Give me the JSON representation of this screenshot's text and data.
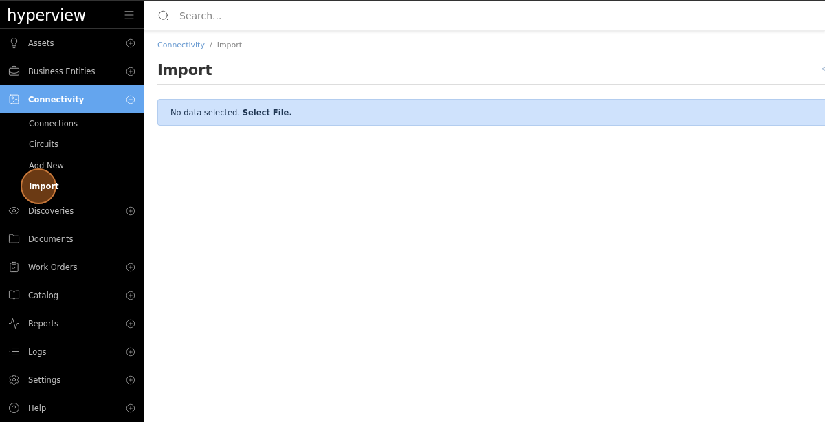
{
  "logo": "hyperview",
  "sidebar": {
    "items": [
      {
        "label": "Assets",
        "kind": "expandable",
        "expanded": false,
        "selected": false
      },
      {
        "label": "Business Entities",
        "kind": "expandable",
        "expanded": false,
        "selected": false
      },
      {
        "label": "Connectivity",
        "kind": "expandable",
        "expanded": true,
        "selected": true,
        "children": [
          {
            "label": "Connections",
            "selected": false
          },
          {
            "label": "Circuits",
            "selected": false
          },
          {
            "label": "Add New",
            "selected": false
          },
          {
            "label": "Import",
            "selected": true
          }
        ]
      },
      {
        "label": "Discoveries",
        "kind": "expandable",
        "expanded": false,
        "selected": false
      },
      {
        "label": "Documents",
        "kind": "plain",
        "selected": false
      },
      {
        "label": "Work Orders",
        "kind": "expandable",
        "expanded": false,
        "selected": false
      },
      {
        "label": "Catalog",
        "kind": "expandable",
        "expanded": false,
        "selected": false
      },
      {
        "label": "Reports",
        "kind": "expandable",
        "expanded": false,
        "selected": false
      },
      {
        "label": "Logs",
        "kind": "expandable",
        "expanded": false,
        "selected": false
      },
      {
        "label": "Settings",
        "kind": "expandable",
        "expanded": false,
        "selected": false
      },
      {
        "label": "Help",
        "kind": "expandable",
        "expanded": false,
        "selected": false
      }
    ]
  },
  "search": {
    "placeholder": "Search..."
  },
  "breadcrumb": [
    {
      "label": "Connectivity",
      "kind": "link"
    },
    {
      "label": "/",
      "kind": "separator"
    },
    {
      "label": "Import",
      "kind": "current"
    }
  ],
  "page_title": "Import",
  "alert": {
    "text": "No data selected.",
    "action": "Select File."
  }
}
